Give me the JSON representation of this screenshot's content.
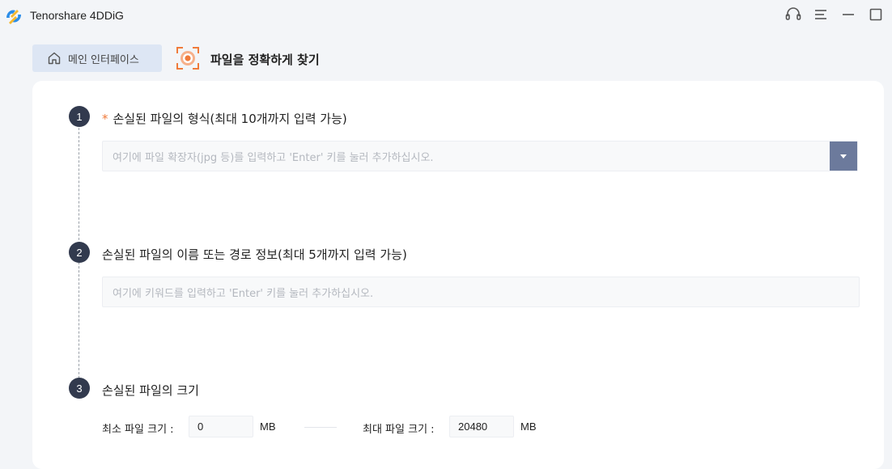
{
  "app": {
    "title": "Tenorshare 4DDiG"
  },
  "window_controls": {
    "support_icon": "headset-icon",
    "menu_icon": "hamburger-menu-icon",
    "minimize_icon": "minimize-icon",
    "maximize_icon": "maximize-icon"
  },
  "nav": {
    "home_label": "메인 인터페이스",
    "page_title": "파일을 정확하게 찾기"
  },
  "colors": {
    "accent": "#f07a3a",
    "step_badge": "#323a4e",
    "dropdown": "#6c7a9c"
  },
  "steps": [
    {
      "number": "1",
      "required_mark": "*",
      "title": "손실된 파일의 형식(최대 10개까지 입력 가능)",
      "placeholder": "여기에 파일 확장자(jpg 등)를 입력하고 'Enter' 키를 눌러 추가하십시오."
    },
    {
      "number": "2",
      "title": "손실된 파일의 이름 또는 경로 정보(최대 5개까지 입력 가능)",
      "placeholder": "여기에 키워드를 입력하고 'Enter' 키를 눌러 추가하십시오."
    },
    {
      "number": "3",
      "title": "손실된 파일의 크기",
      "min_label": "최소 파일 크기 :",
      "min_value": "0",
      "min_unit": "MB",
      "max_label": "최대 파일 크기 :",
      "max_value": "20480",
      "max_unit": "MB"
    }
  ]
}
